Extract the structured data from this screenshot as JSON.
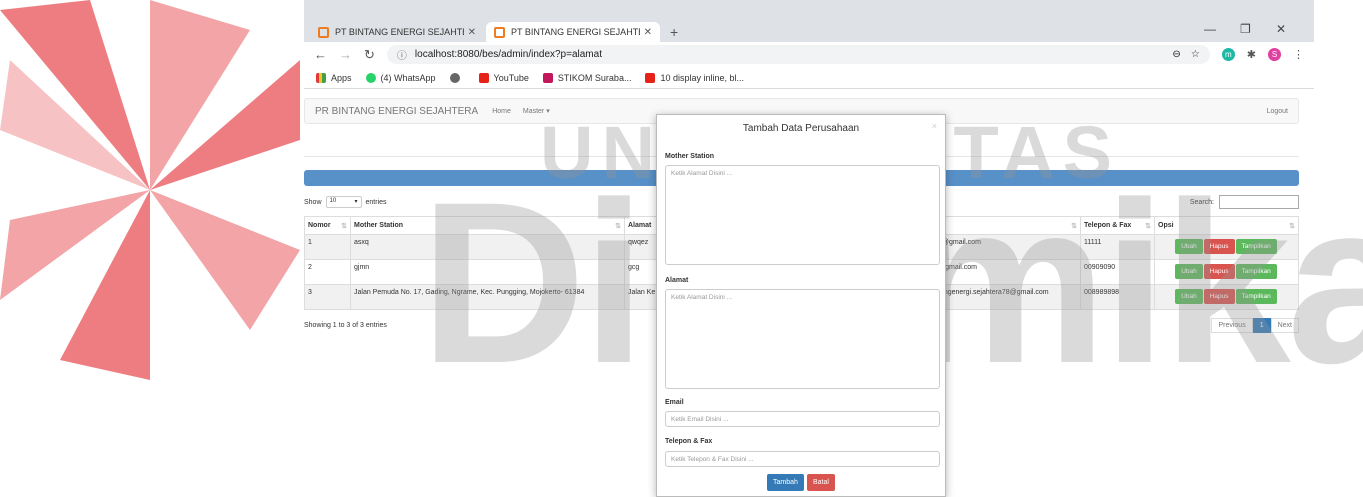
{
  "watermark": {
    "line1": "UNIVERSITAS",
    "line2": "Dinamika"
  },
  "browser": {
    "tabs": [
      {
        "title": "PT BINTANG ENERGI SEJAHTERA"
      },
      {
        "title": "PT BINTANG ENERGI SEJAHTERA"
      }
    ],
    "url": "localhost:8080/bes/admin/index?p=alamat",
    "bookmarks": [
      "Apps",
      "(4) WhatsApp",
      "YouTube",
      "STIKOM Suraba...",
      "10 display inline, bl..."
    ],
    "avatar_letters": [
      "m",
      "S"
    ]
  },
  "navbar": {
    "brand": "PR BINTANG ENERGI SEJAHTERA",
    "home": "Home",
    "master": "Master ▾",
    "logout": "Logout"
  },
  "table": {
    "show_label": "Show",
    "entries_label": "entries",
    "page_size": "10",
    "search_label": "Search:",
    "headers": [
      "Nomor",
      "Mother Station",
      "Alamat",
      "Email",
      "Telepon & Fax",
      "Opsi"
    ],
    "visible_headers": [
      "Nomor",
      "Mother Station",
      "Alamat",
      "ail",
      "Telepon & Fax",
      "Opsi"
    ],
    "rows": [
      {
        "no": "1",
        "station": "asxq",
        "alamat": "qwqez",
        "email": "n@gmail.com",
        "tel": "11111"
      },
      {
        "no": "2",
        "station": "gjmn",
        "alamat": "gcg",
        "email": "@gmail.com",
        "tel": "00909090"
      },
      {
        "no": "3",
        "station": "Jalan Pemuda No. 17, Gading, Ngrame, Kec. Pungging, Mojokerto- 61384",
        "alamat": "Jalan Ke",
        "email": "tangenergi.sejahtera78@gmail.com",
        "tel": "008989898"
      }
    ],
    "btn_ubah": "Ubah",
    "btn_hapus": "Hapus",
    "btn_tampil": "Tampilkan",
    "info": "Showing 1 to 3 of 3 entries",
    "prev": "Previous",
    "page": "1",
    "next": "Next"
  },
  "modal": {
    "title": "Tambah Data Perusahaan",
    "close": "×",
    "station_label": "Mother Station",
    "station_ph": "Ketik Alamat Disini ...",
    "alamat_label": "Alamat",
    "alamat_ph": "Ketik Alamat Disini ...",
    "email_label": "Email",
    "email_ph": "Ketik Email Disini ...",
    "tel_label": "Telepon & Fax",
    "tel_ph": "Ketik Telepon & Fax Disini ...",
    "btn_tambah": "Tambah",
    "btn_batal": "Batal"
  },
  "colors": {
    "accent": "#5891c8",
    "success": "#5cb85c",
    "danger": "#d9534f",
    "primary": "#337ab7",
    "tab_icon": "#f07c22"
  }
}
